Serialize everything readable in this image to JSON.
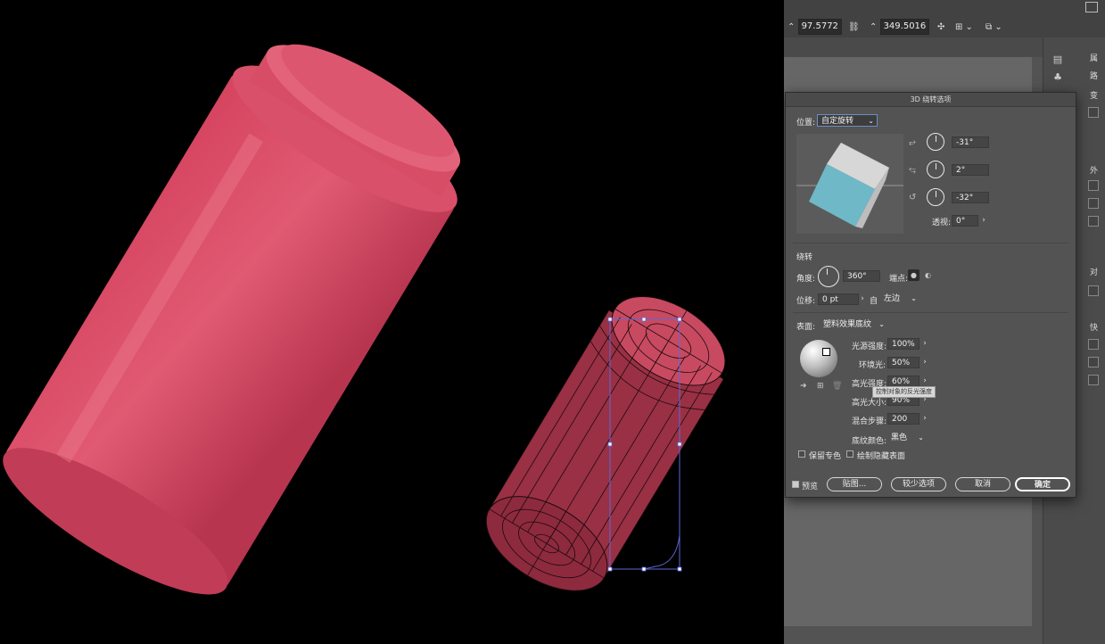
{
  "control_bar": {
    "width_value": "97.5772",
    "height_value": "349.5016"
  },
  "dialog": {
    "title": "3D 绕转选项",
    "position_label": "位置:",
    "position_value": "自定旋转",
    "rot_x": "-31°",
    "rot_y": "2°",
    "rot_z": "-32°",
    "perspective_label": "透视:",
    "perspective_value": "0°",
    "revolve_section": "绕转",
    "angle_label": "角度:",
    "angle_value": "360°",
    "cap_label": "端点:",
    "offset_label": "位移:",
    "offset_value": "0 pt",
    "from_label": "自",
    "from_value": "左边",
    "surface_label": "表面:",
    "surface_value": "塑料效果底纹",
    "light_intensity_label": "光源强度:",
    "light_intensity_value": "100%",
    "ambient_label": "环境光:",
    "ambient_value": "50%",
    "highlight_intensity_label": "高光强度:",
    "highlight_intensity_value": "60%",
    "highlight_size_label": "高光大小:",
    "highlight_size_value": "90%",
    "blend_steps_label": "混合步骤:",
    "blend_steps_value": "200",
    "shade_color_label": "底纹颜色:",
    "shade_color_value": "黑色",
    "preserve_spot_label": "保留专色",
    "draw_hidden_label": "绘制隐藏表面",
    "preview_label": "预览",
    "map_button": "贴图...",
    "fewer_options_button": "较少选项",
    "cancel_button": "取消",
    "ok_button": "确定",
    "tooltip": "控制对象的反光强度"
  },
  "panel_column": {
    "labels": [
      "属",
      "路",
      "变",
      "外",
      "对",
      "快"
    ]
  },
  "colors": {
    "can_red": "#d94a62",
    "cube_top": "#d7d7d7",
    "cube_front": "#6fb8c8",
    "selection": "#5a6ad8"
  }
}
